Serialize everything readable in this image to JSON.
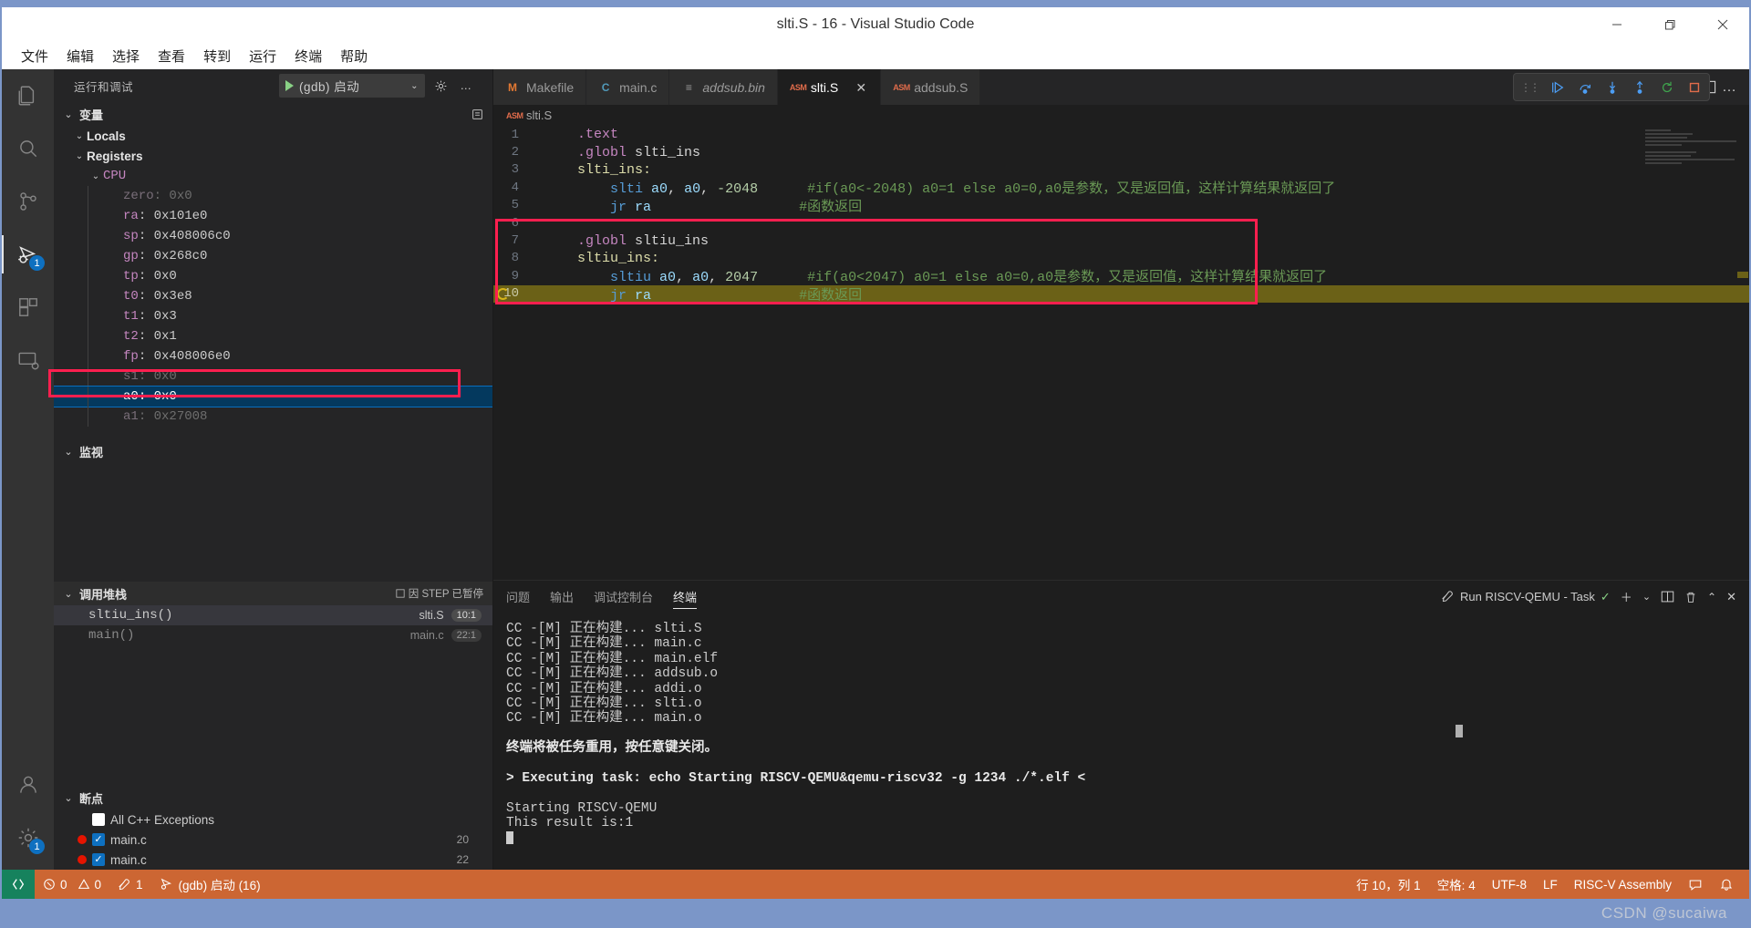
{
  "window": {
    "title": "slti.S - 16 - Visual Studio Code",
    "minimize": "−",
    "maximize": "❐",
    "close": "✕"
  },
  "menubar": {
    "items": [
      "文件",
      "编辑",
      "选择",
      "查看",
      "转到",
      "运行",
      "终端",
      "帮助"
    ]
  },
  "activitybar": {
    "items": [
      {
        "name": "explorer",
        "badge": ""
      },
      {
        "name": "search",
        "badge": ""
      },
      {
        "name": "source-control",
        "badge": ""
      },
      {
        "name": "run-and-debug",
        "badge": "1"
      },
      {
        "name": "extensions",
        "badge": ""
      },
      {
        "name": "remote-explorer",
        "badge": ""
      }
    ],
    "bottom": [
      {
        "name": "accounts",
        "badge": ""
      },
      {
        "name": "settings",
        "badge": "1"
      }
    ]
  },
  "sidebar": {
    "header_title": "运行和调试",
    "launch_config": "(gdb) 启动",
    "gear_icon": "gear-icon",
    "more_icon": "…",
    "variables": {
      "title": "变量",
      "groups": [
        {
          "label": "Locals",
          "expanded": true
        },
        {
          "label": "Registers",
          "expanded": true
        }
      ],
      "cpu_label": "CPU",
      "registers": [
        {
          "name": "zero",
          "value": "0x0",
          "state": "dim"
        },
        {
          "name": "ra",
          "value": "0x101e0",
          "state": "normal"
        },
        {
          "name": "sp",
          "value": "0x408006c0",
          "state": "normal"
        },
        {
          "name": "gp",
          "value": "0x268c0",
          "state": "normal"
        },
        {
          "name": "tp",
          "value": "0x0",
          "state": "normal"
        },
        {
          "name": "t0",
          "value": "0x3e8",
          "state": "normal"
        },
        {
          "name": "t1",
          "value": "0x3",
          "state": "normal"
        },
        {
          "name": "t2",
          "value": "0x1",
          "state": "normal"
        },
        {
          "name": "fp",
          "value": "0x408006e0",
          "state": "normal"
        },
        {
          "name": "s1",
          "value": "0x0",
          "state": "dim"
        },
        {
          "name": "a0",
          "value": "0x0",
          "state": "selected"
        },
        {
          "name": "a1",
          "value": "0x27008",
          "state": "dim"
        }
      ]
    },
    "watch": {
      "title": "监视"
    },
    "callstack": {
      "title": "调用堆栈",
      "status": "因 STEP 已暂停",
      "frames": [
        {
          "fn": "sltiu_ins()",
          "file": "slti.S",
          "pos": "10:1",
          "selected": true
        },
        {
          "fn": "main()",
          "file": "main.c",
          "pos": "22:1",
          "selected": false
        }
      ]
    },
    "breakpoints": {
      "title": "断点",
      "items": [
        {
          "label": "All C++ Exceptions",
          "checked": false,
          "dot": false,
          "line": ""
        },
        {
          "label": "main.c",
          "checked": true,
          "dot": true,
          "line": "20"
        },
        {
          "label": "main.c",
          "checked": true,
          "dot": true,
          "line": "22"
        }
      ]
    }
  },
  "editor": {
    "tabs": [
      {
        "label": "Makefile",
        "icon": "M",
        "icon_color": "#e37933",
        "active": false,
        "italic": false,
        "closeable": false
      },
      {
        "label": "main.c",
        "icon": "C",
        "icon_color": "#519aba",
        "active": false,
        "italic": false,
        "closeable": false
      },
      {
        "label": "addsub.bin",
        "icon": "≡",
        "icon_color": "#cccccc",
        "active": false,
        "italic": true,
        "closeable": false
      },
      {
        "label": "slti.S",
        "icon": "ASM",
        "icon_color": "#e06c4b",
        "active": true,
        "italic": false,
        "closeable": true
      },
      {
        "label": "addsub.S",
        "icon": "ASM",
        "icon_color": "#e06c4b",
        "active": false,
        "italic": false,
        "closeable": false
      }
    ],
    "tab_close_label": "✕",
    "split_editor_icon": "split-editor-icon",
    "more_actions_icon": "…",
    "debug_toolbar": [
      {
        "name": "continue-button",
        "label": "▷"
      },
      {
        "name": "step-over-button",
        "label": "↷"
      },
      {
        "name": "step-into-button",
        "label": "↓"
      },
      {
        "name": "step-out-button",
        "label": "↑"
      },
      {
        "name": "restart-button",
        "label": "↺"
      },
      {
        "name": "stop-button",
        "label": "■"
      }
    ],
    "breadcrumb": "slti.S",
    "lines": [
      {
        "n": "1",
        "tokens": [
          {
            "t": "    ",
            "c": "plain"
          },
          {
            "t": ".text",
            "c": "dir"
          }
        ]
      },
      {
        "n": "2",
        "tokens": [
          {
            "t": "    ",
            "c": "plain"
          },
          {
            "t": ".globl",
            "c": "dir"
          },
          {
            "t": " slti_ins",
            "c": "plain"
          }
        ]
      },
      {
        "n": "3",
        "tokens": [
          {
            "t": "    ",
            "c": "plain"
          },
          {
            "t": "slti_ins:",
            "c": "label"
          }
        ]
      },
      {
        "n": "4",
        "tokens": [
          {
            "t": "        ",
            "c": "plain"
          },
          {
            "t": "slti",
            "c": "ins"
          },
          {
            "t": " ",
            "c": "plain"
          },
          {
            "t": "a0",
            "c": "reg"
          },
          {
            "t": ", ",
            "c": "plain"
          },
          {
            "t": "a0",
            "c": "reg"
          },
          {
            "t": ", ",
            "c": "plain"
          },
          {
            "t": "-2048",
            "c": "num"
          },
          {
            "t": "      ",
            "c": "plain"
          },
          {
            "t": "#if(a0<-2048) a0=1 else a0=0,a0是参数，又是返回值，这样计算结果就返回了",
            "c": "cmt"
          }
        ]
      },
      {
        "n": "5",
        "tokens": [
          {
            "t": "        ",
            "c": "plain"
          },
          {
            "t": "jr",
            "c": "ins"
          },
          {
            "t": " ",
            "c": "plain"
          },
          {
            "t": "ra",
            "c": "reg"
          },
          {
            "t": "                    ",
            "c": "plain"
          },
          {
            "t": "#函数返回",
            "c": "cmt"
          }
        ]
      },
      {
        "n": "6",
        "tokens": []
      },
      {
        "n": "7",
        "tokens": [
          {
            "t": "    ",
            "c": "plain"
          },
          {
            "t": ".globl",
            "c": "dir"
          },
          {
            "t": " sltiu_ins",
            "c": "plain"
          }
        ]
      },
      {
        "n": "8",
        "tokens": [
          {
            "t": "    ",
            "c": "plain"
          },
          {
            "t": "sltiu_ins:",
            "c": "label"
          }
        ]
      },
      {
        "n": "9",
        "tokens": [
          {
            "t": "        ",
            "c": "plain"
          },
          {
            "t": "sltiu",
            "c": "ins"
          },
          {
            "t": " ",
            "c": "plain"
          },
          {
            "t": "a0",
            "c": "reg"
          },
          {
            "t": ", ",
            "c": "plain"
          },
          {
            "t": "a0",
            "c": "reg"
          },
          {
            "t": ", ",
            "c": "plain"
          },
          {
            "t": "2047",
            "c": "num"
          },
          {
            "t": "      ",
            "c": "plain"
          },
          {
            "t": "#if(a0<2047) a0=1 else a0=0,a0是参数，又是返回值，这样计算结果就返回了",
            "c": "cmt"
          }
        ]
      },
      {
        "n": "10",
        "tokens": [
          {
            "t": "        ",
            "c": "plain"
          },
          {
            "t": "jr",
            "c": "ins"
          },
          {
            "t": " ",
            "c": "plain"
          },
          {
            "t": "ra",
            "c": "reg"
          },
          {
            "t": "                    ",
            "c": "plain"
          },
          {
            "t": "#函数返回",
            "c": "cmt"
          }
        ],
        "current": true,
        "breakpoint_arrow": true
      }
    ]
  },
  "panel": {
    "tabs": [
      {
        "label": "问题",
        "active": false
      },
      {
        "label": "输出",
        "active": false
      },
      {
        "label": "调试控制台",
        "active": false
      },
      {
        "label": "终端",
        "active": true
      }
    ],
    "task_label": "Run RISCV-QEMU - Task",
    "task_check": "✓",
    "actions": [
      "＋",
      "⌄",
      "◫",
      "🗑",
      "⌃",
      "✕"
    ],
    "terminal_lines": [
      {
        "text": "CC -[M] 正在构建... slti.S",
        "style": "normal"
      },
      {
        "text": "CC -[M] 正在构建... main.c",
        "style": "normal"
      },
      {
        "text": "CC -[M] 正在构建... main.elf",
        "style": "normal"
      },
      {
        "text": "CC -[M] 正在构建... addsub.o",
        "style": "normal"
      },
      {
        "text": "CC -[M] 正在构建... addi.o",
        "style": "normal"
      },
      {
        "text": "CC -[M] 正在构建... slti.o",
        "style": "normal"
      },
      {
        "text": "CC -[M] 正在构建... main.o",
        "style": "normal"
      },
      {
        "text": "",
        "style": "blank"
      },
      {
        "text": "终端将被任务重用，按任意键关闭。",
        "style": "bold"
      },
      {
        "text": "",
        "style": "blank"
      },
      {
        "text": "> Executing task: echo Starting RISCV-QEMU&qemu-riscv32 -g 1234 ./*.elf <",
        "style": "normal"
      },
      {
        "text": "",
        "style": "blank"
      },
      {
        "text": "Starting RISCV-QEMU",
        "style": "normal"
      },
      {
        "text": "This result is:1",
        "style": "normal"
      },
      {
        "text": "",
        "style": "cursor"
      }
    ]
  },
  "statusbar": {
    "remote_icon": "remote-icon",
    "errors": "0",
    "warnings": "0",
    "ports": "1",
    "launch": "(gdb) 启动 (16)",
    "position": "行 10，列 1",
    "indent": "空格: 4",
    "encoding": "UTF-8",
    "eol": "LF",
    "language": "RISC-V Assembly",
    "feedback_icon": "feedback-icon",
    "bell_icon": "bell-icon"
  },
  "watermark": "CSDN @sucaiwa",
  "colors": {
    "accent_orange": "#cc6633",
    "remote_green": "#16825d",
    "annotation_red": "#ff1f4f",
    "selection_blue": "#04395e",
    "current_line": "#6b6117"
  }
}
